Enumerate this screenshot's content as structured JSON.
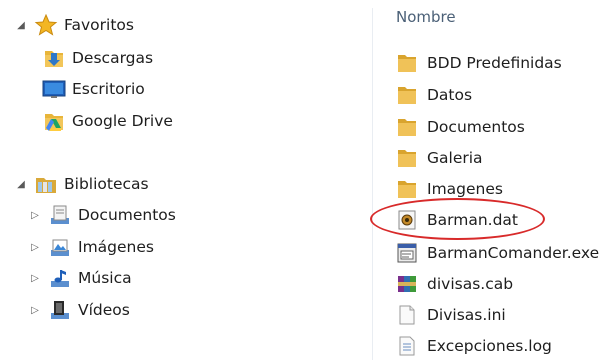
{
  "navigation": {
    "favorites": {
      "label": "Favoritos",
      "items": [
        {
          "label": "Descargas",
          "icon": "downloads-folder-icon"
        },
        {
          "label": "Escritorio",
          "icon": "desktop-icon"
        },
        {
          "label": "Google Drive",
          "icon": "google-drive-folder-icon"
        }
      ]
    },
    "libraries": {
      "label": "Bibliotecas",
      "items": [
        {
          "label": "Documentos",
          "icon": "documents-library-icon"
        },
        {
          "label": "Imágenes",
          "icon": "pictures-library-icon"
        },
        {
          "label": "Música",
          "icon": "music-library-icon"
        },
        {
          "label": "Vídeos",
          "icon": "videos-library-icon"
        }
      ]
    }
  },
  "file_list": {
    "column_header": "Nombre",
    "items": [
      {
        "name": "BDD Predefinidas",
        "type": "folder"
      },
      {
        "name": "Datos",
        "type": "folder"
      },
      {
        "name": "Documentos",
        "type": "folder"
      },
      {
        "name": "Galeria",
        "type": "folder"
      },
      {
        "name": "Imagenes",
        "type": "folder"
      },
      {
        "name": "Barman.dat",
        "type": "dat",
        "highlighted": true
      },
      {
        "name": "BarmanComander.exe",
        "type": "exe"
      },
      {
        "name": "divisas.cab",
        "type": "cab"
      },
      {
        "name": "Divisas.ini",
        "type": "ini"
      },
      {
        "name": "Excepciones.log",
        "type": "log"
      }
    ]
  },
  "colors": {
    "annotation_red": "#d82a2a",
    "folder_yellow": "#e8b53a",
    "header_text": "#4b6077"
  }
}
